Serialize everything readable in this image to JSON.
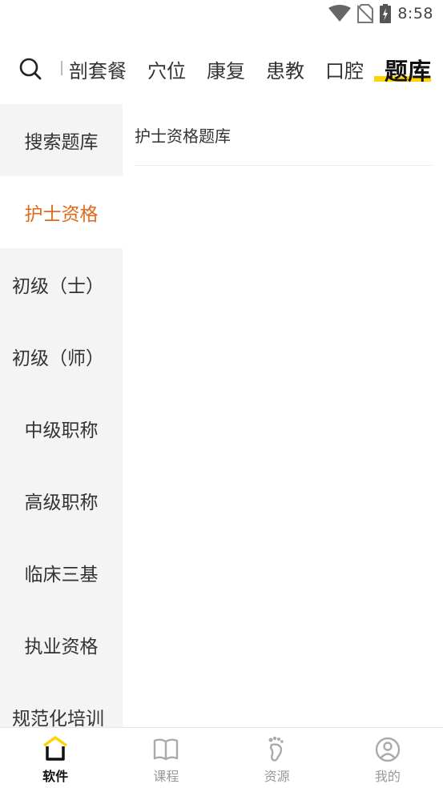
{
  "status_bar": {
    "time": "8:58",
    "icons": [
      "wifi-icon",
      "no-sim-icon",
      "battery-charging-icon"
    ]
  },
  "top_nav": {
    "search_icon": "search-icon",
    "tabs": [
      {
        "label": "剖套餐"
      },
      {
        "label": "穴位"
      },
      {
        "label": "康复"
      },
      {
        "label": "患教"
      },
      {
        "label": "口腔"
      },
      {
        "label": "题库",
        "active": true
      }
    ],
    "active_color": "#ffd400"
  },
  "sidebar": {
    "items": [
      {
        "label": "搜索题库"
      },
      {
        "label": "护士资格",
        "active": true
      },
      {
        "label": "初级（士）"
      },
      {
        "label": "初级（师）"
      },
      {
        "label": "中级职称"
      },
      {
        "label": "高级职称"
      },
      {
        "label": "临床三基"
      },
      {
        "label": "执业资格"
      },
      {
        "label": "规范化培训"
      }
    ],
    "active_color": "#e06a1b"
  },
  "content": {
    "items": [
      {
        "label": "护士资格题库"
      }
    ]
  },
  "bottom_bar": {
    "tabs": [
      {
        "label": "软件",
        "icon": "home-icon",
        "active": true
      },
      {
        "label": "课程",
        "icon": "book-icon"
      },
      {
        "label": "资源",
        "icon": "footprint-icon"
      },
      {
        "label": "我的",
        "icon": "profile-icon"
      }
    ]
  }
}
